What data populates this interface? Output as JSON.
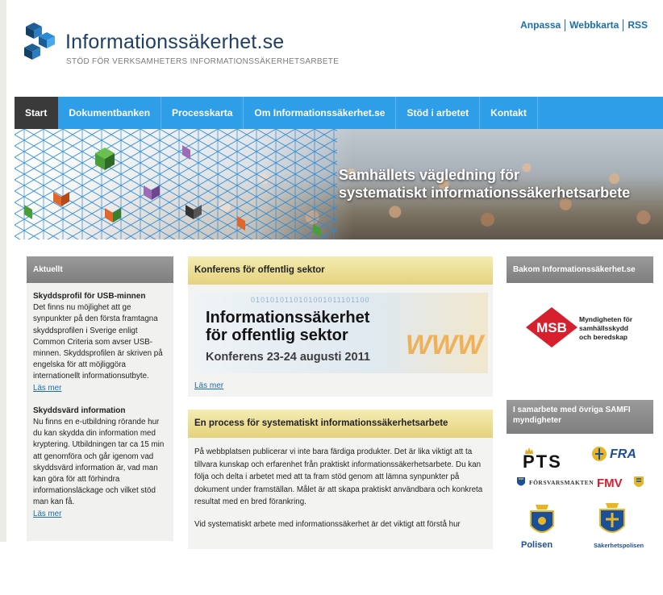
{
  "header": {
    "site_name": "Informationssäkerhet.se",
    "tagline": "STÖD FÖR VERKSAMHETERS INFORMATIONSSÄKERHETSARBETE",
    "top_links": [
      "Anpassa",
      "Webbkarta",
      "RSS"
    ]
  },
  "nav": {
    "items": [
      "Start",
      "Dokumentbanken",
      "Processkarta",
      "Om Informationssäkerhet.se",
      "Stöd i arbetet",
      "Kontakt"
    ],
    "active": "Start"
  },
  "hero": {
    "line1": "Samhällets vägledning för",
    "line2": "systematiskt informationssäkerhetsarbete"
  },
  "aktuellt": {
    "heading": "Aktuellt",
    "items": [
      {
        "title": "Skyddsprofil för USB-minnen",
        "text": "Det finns nu möjlighet att ge synpunkter på den första framtagna skyddsprofilen i Sverige enligt Common Criteria som avser USB-minnen. Skyddsprofilen är skriven på engelska för att möjliggöra internationellt informationsutbyte.",
        "more": "Läs mer"
      },
      {
        "title": "Skyddsvärd information",
        "text": "Nu finns en e-utbildning rörande hur du kan skydda din information med kryptering. Utbildningen tar ca 15 min att genomföra och går igenom vad skyddsvärd information är, vad man kan göra för att förhindra informationsläckage och vilket stöd man kan få.",
        "more": "Läs mer"
      }
    ]
  },
  "konferens": {
    "heading": "Konferens för offentlig sektor",
    "banner_line1": "Informationssäkerhet",
    "banner_line2": "för offentlig sektor",
    "banner_line3": "Konferens 23-24 augusti 2011",
    "banner_binary": "0101010110101001011101100",
    "banner_www": "WWW",
    "more": "Läs mer"
  },
  "process": {
    "heading": "En process för systematiskt informationssäkerhetsarbete",
    "paragraph1": "På webbplatsen publicerar vi inte bara färdiga produkter. Det är lika viktigt att ta tillvara kunskap och erfarenhet från praktiskt informationssäkerhetsarbete. Du kan följa och delta i arbetet med att ta fram stöd genom att lämna synpunkter på dokument under framställan. Målet är att skapa praktiskt användbara och konkreta resultat med en bred förankring.",
    "paragraph2": "Vid systematiskt arbete med informationssäkerhet är det viktigt att förstå hur"
  },
  "bakom": {
    "heading": "Bakom Informationssäkerhet.se",
    "msb_mark": "MSB",
    "msb_name_1": "Myndigheten för",
    "msb_name_2": "samhällsskydd",
    "msb_name_3": "och beredskap"
  },
  "samfi": {
    "heading": "I samarbete med övriga SAMFI myndigheter",
    "logos": [
      "PTS",
      "FRA",
      "FÖRSVARSMAKTEN",
      "FMV",
      "Polisen",
      "Säkerhetspolisen"
    ]
  },
  "colors": {
    "nav_blue": "#2e9ee8",
    "nav_active": "#3a3a3a",
    "brand_navy": "#1f3f63",
    "link_blue": "#1c6ea8",
    "msb_red": "#d6202e",
    "yellow_header": "#e5d27c"
  }
}
